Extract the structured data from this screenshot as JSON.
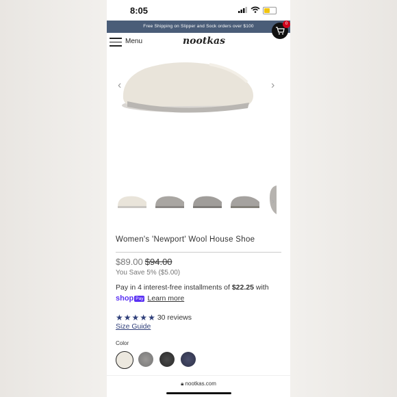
{
  "status": {
    "time": "8:05"
  },
  "banner": {
    "text": "Free Shipping on Slipper and Sock orders over $100"
  },
  "cart": {
    "count": "0"
  },
  "header": {
    "menu_label": "Menu",
    "logo": "nootkas"
  },
  "product": {
    "title": "Women's 'Newport' Wool House Shoe",
    "price": "$89.00",
    "old_price": "$94.00",
    "savings": "You Save 5% ($5.00)",
    "installments_prefix": "Pay in 4 interest-free installments of ",
    "installment_amount": "$22.25",
    "installments_suffix": " with",
    "shop_label": "shop",
    "pay_badge": "Pay",
    "learn_more": "Learn more",
    "rating": 5,
    "reviews": "30 reviews",
    "size_guide": "Size Guide",
    "color_label": "Color",
    "colors": [
      "#ece8df",
      "#8c8a88",
      "#3a3a3a",
      "#3b3f5a"
    ]
  },
  "browser": {
    "url": "nootkas.com"
  },
  "icons": [
    "signal-icon",
    "wifi-icon",
    "battery-icon",
    "cart-icon",
    "menu-icon",
    "chevron-left-icon",
    "chevron-right-icon",
    "lock-icon",
    "star-icon"
  ]
}
